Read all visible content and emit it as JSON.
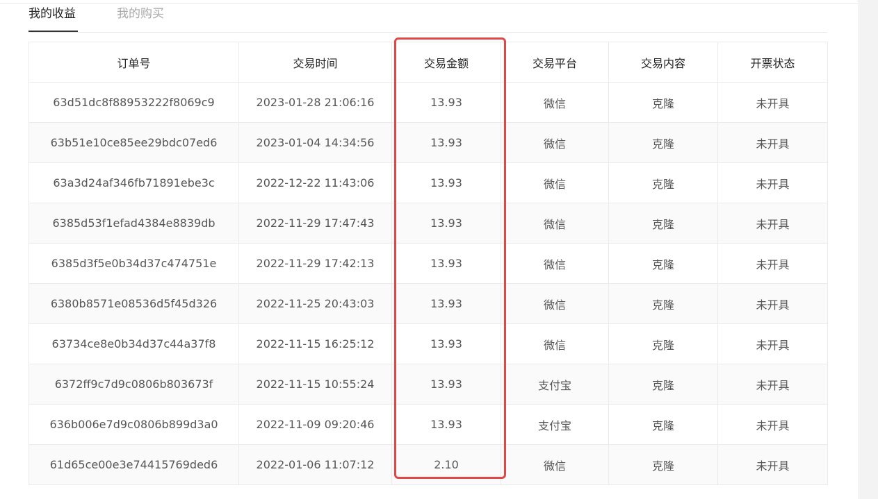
{
  "tabs": {
    "earnings": "我的收益",
    "purchases": "我的购买"
  },
  "table": {
    "headers": {
      "order_no": "订单号",
      "trade_time": "交易时间",
      "amount": "交易金额",
      "platform": "交易平台",
      "content": "交易内容",
      "invoice": "开票状态"
    },
    "rows": [
      {
        "order_no": "63d51dc8f88953222f8069c9",
        "trade_time": "2023-01-28 21:06:16",
        "amount": "13.93",
        "platform": "微信",
        "content": "克隆",
        "invoice": "未开具"
      },
      {
        "order_no": "63b51e10ce85ee29bdc07ed6",
        "trade_time": "2023-01-04 14:34:56",
        "amount": "13.93",
        "platform": "微信",
        "content": "克隆",
        "invoice": "未开具"
      },
      {
        "order_no": "63a3d24af346fb71891ebe3c",
        "trade_time": "2022-12-22 11:43:06",
        "amount": "13.93",
        "platform": "微信",
        "content": "克隆",
        "invoice": "未开具"
      },
      {
        "order_no": "6385d53f1efad4384e8839db",
        "trade_time": "2022-11-29 17:47:43",
        "amount": "13.93",
        "platform": "微信",
        "content": "克隆",
        "invoice": "未开具"
      },
      {
        "order_no": "6385d3f5e0b34d37c474751e",
        "trade_time": "2022-11-29 17:42:13",
        "amount": "13.93",
        "platform": "微信",
        "content": "克隆",
        "invoice": "未开具"
      },
      {
        "order_no": "6380b8571e08536d5f45d326",
        "trade_time": "2022-11-25 20:43:03",
        "amount": "13.93",
        "platform": "微信",
        "content": "克隆",
        "invoice": "未开具"
      },
      {
        "order_no": "63734ce8e0b34d37c44a37f8",
        "trade_time": "2022-11-15 16:25:12",
        "amount": "13.93",
        "platform": "微信",
        "content": "克隆",
        "invoice": "未开具"
      },
      {
        "order_no": "6372ff9c7d9c0806b803673f",
        "trade_time": "2022-11-15 10:55:24",
        "amount": "13.93",
        "platform": "支付宝",
        "content": "克隆",
        "invoice": "未开具"
      },
      {
        "order_no": "636b006e7d9c0806b899d3a0",
        "trade_time": "2022-11-09 09:20:46",
        "amount": "13.93",
        "platform": "支付宝",
        "content": "克隆",
        "invoice": "未开具"
      },
      {
        "order_no": "61d65ce00e3e74415769ded6",
        "trade_time": "2022-01-06 11:07:12",
        "amount": "2.10",
        "platform": "微信",
        "content": "克隆",
        "invoice": "未开具"
      }
    ]
  },
  "colors": {
    "highlight": "#e04848",
    "link": "#8fb3e0"
  }
}
